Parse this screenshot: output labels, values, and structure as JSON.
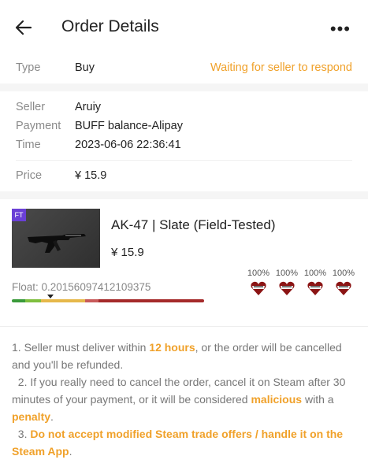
{
  "header": {
    "title": "Order Details",
    "more_label": "•••"
  },
  "order": {
    "type_label": "Type",
    "type_value": "Buy",
    "status": "Waiting for seller to respond",
    "seller_label": "Seller",
    "seller_value": "Aruiy",
    "payment_label": "Payment",
    "payment_value": "BUFF balance-Alipay",
    "time_label": "Time",
    "time_value": "2023-06-06 22:36:41",
    "price_label": "Price",
    "price_value": "¥ 15.9"
  },
  "item": {
    "badge": "FT",
    "name": "AK-47 | Slate (Field-Tested)",
    "price": "¥ 15.9",
    "float_label": "Float: ",
    "float_value": "0.20156097412109375",
    "float_fraction": 0.2016,
    "stickers": [
      {
        "percent": "100%",
        "icon": "sticker-icon"
      },
      {
        "percent": "100%",
        "icon": "sticker-icon"
      },
      {
        "percent": "100%",
        "icon": "sticker-icon"
      },
      {
        "percent": "100%",
        "icon": "sticker-icon"
      }
    ],
    "wear_colors": [
      "#3a9a3a",
      "#7fbf3f",
      "#e6b84a",
      "#c85a5a",
      "#a52a2a"
    ]
  },
  "notes": {
    "n1_a": "1. Seller must deliver within ",
    "n1_hl": "12 hours",
    "n1_b": ", or the order will be cancelled and you'll be refunded.",
    "n2_a": "  2. If you really need to cancel the order, cancel it on Steam after 30 minutes of your payment, or it will be considered ",
    "n2_hl1": "malicious",
    "n2_b": " with a ",
    "n2_hl2": "penalty",
    "n2_c": ".",
    "n3_a": "  3. ",
    "n3_hl": "Do not accept modified Steam trade offers / handle it on the Steam App",
    "n3_b": "."
  },
  "colors": {
    "accent": "#f0a12a",
    "badge_ft": "#6a3fd6"
  }
}
